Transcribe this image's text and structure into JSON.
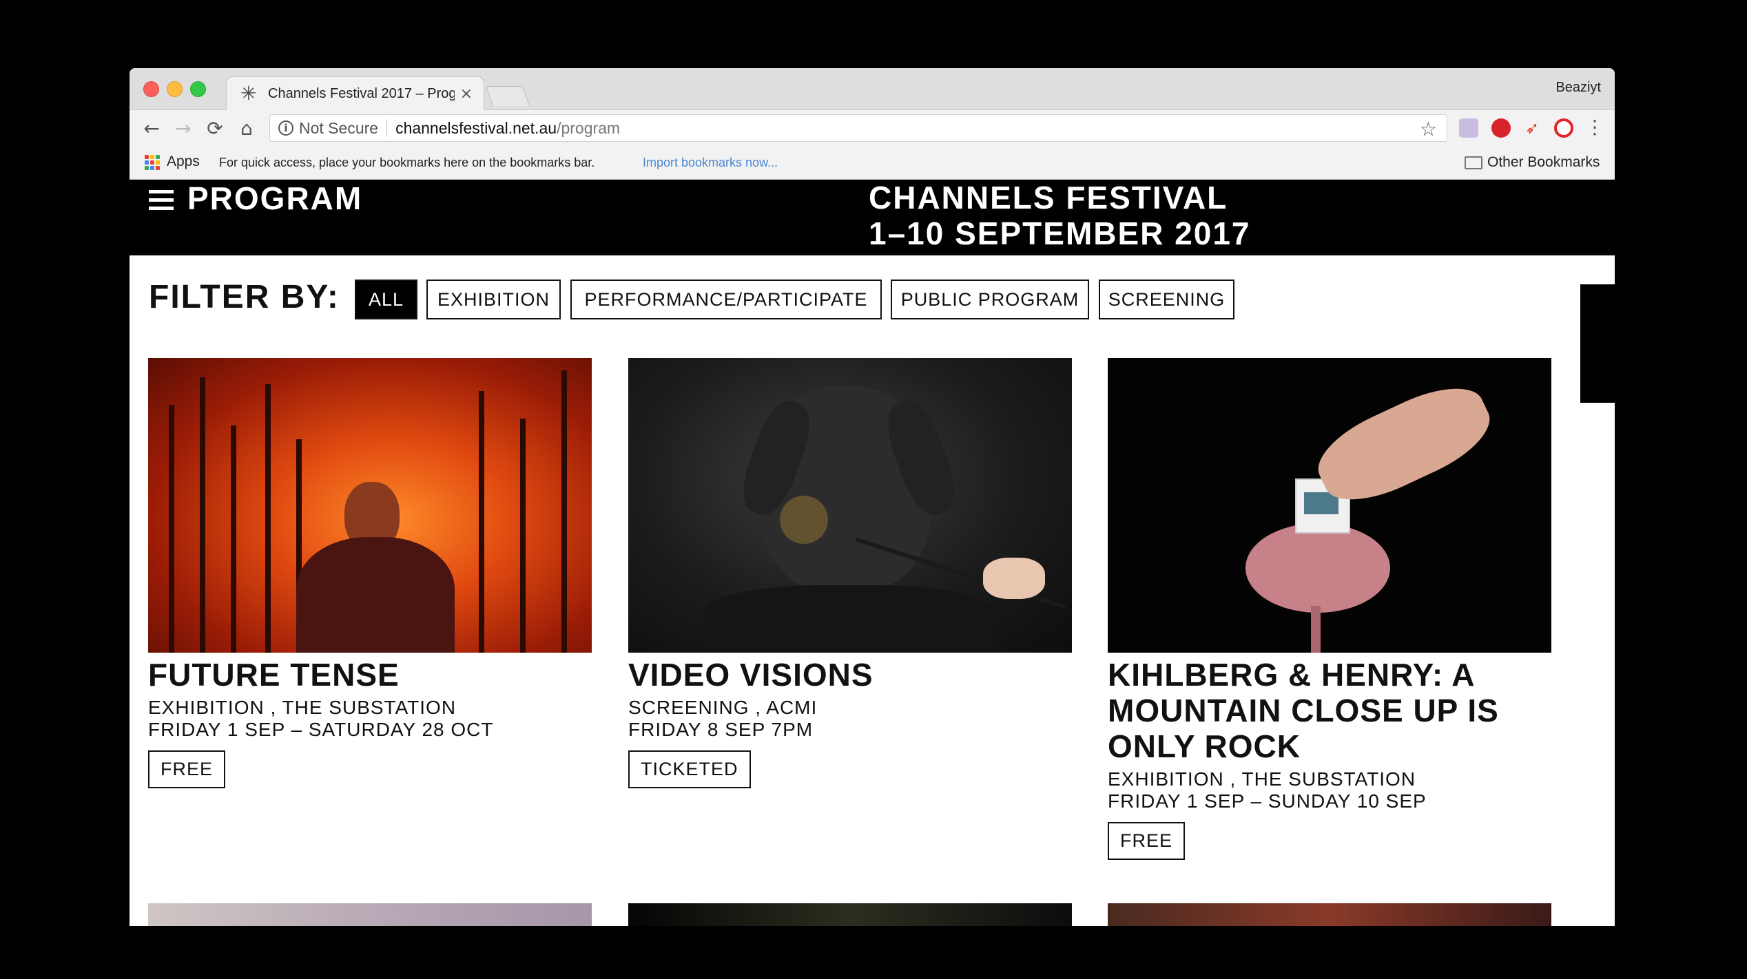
{
  "browser": {
    "tab_title": "Channels Festival 2017 – Progr",
    "tab_close": "×",
    "profile": "Beaziyt",
    "security_label": "Not Secure",
    "url_host": "channelsfestival.net.au",
    "url_path": "/program",
    "bookmarks": {
      "apps_label": "Apps",
      "hint": "For quick access, place your bookmarks here on the bookmarks bar.",
      "import_link": "Import bookmarks now...",
      "other_bookmarks": "Other Bookmarks"
    },
    "icons": {
      "back": "←",
      "forward": "→",
      "reload": "⟳",
      "home": "⌂",
      "star": "☆",
      "info": "i",
      "menu": "⋮",
      "favicon": "✳",
      "rocket": "➶"
    }
  },
  "site": {
    "page_title": "PROGRAM",
    "festival_line1": "CHANNELS FESTIVAL",
    "festival_line2": "1–10 SEPTEMBER 2017",
    "filter_label": "FILTER BY:",
    "filters": [
      "ALL",
      "EXHIBITION",
      "PERFORMANCE/PARTICIPATE",
      "PUBLIC PROGRAM",
      "SCREENING"
    ],
    "active_filter": "ALL"
  },
  "cards": [
    {
      "title": "FUTURE TENSE",
      "category_venue": "EXHIBITION , THE SUBSTATION",
      "dates": "FRIDAY 1 SEP – SATURDAY 28 OCT",
      "badge": "FREE",
      "image": "woman-in-front-of-bushfire"
    },
    {
      "title": "VIDEO VISIONS",
      "category_venue": "SCREENING , ACMI",
      "dates": "FRIDAY 8 SEP 7PM",
      "badge": "TICKETED",
      "image": "dog-mask-being-painted"
    },
    {
      "title": "KIHLBERG & HENRY: A MOUNTAIN CLOSE UP IS ONLY ROCK",
      "category_venue": "EXHIBITION , THE SUBSTATION",
      "dates": "FRIDAY 1 SEP – SUNDAY 10 SEP",
      "badge": "FREE",
      "image": "hand-holding-slide-over-brain"
    }
  ],
  "colors": {
    "header_bg": "#000000",
    "header_text": "#ffffff",
    "link_blue": "#4a86d4"
  }
}
